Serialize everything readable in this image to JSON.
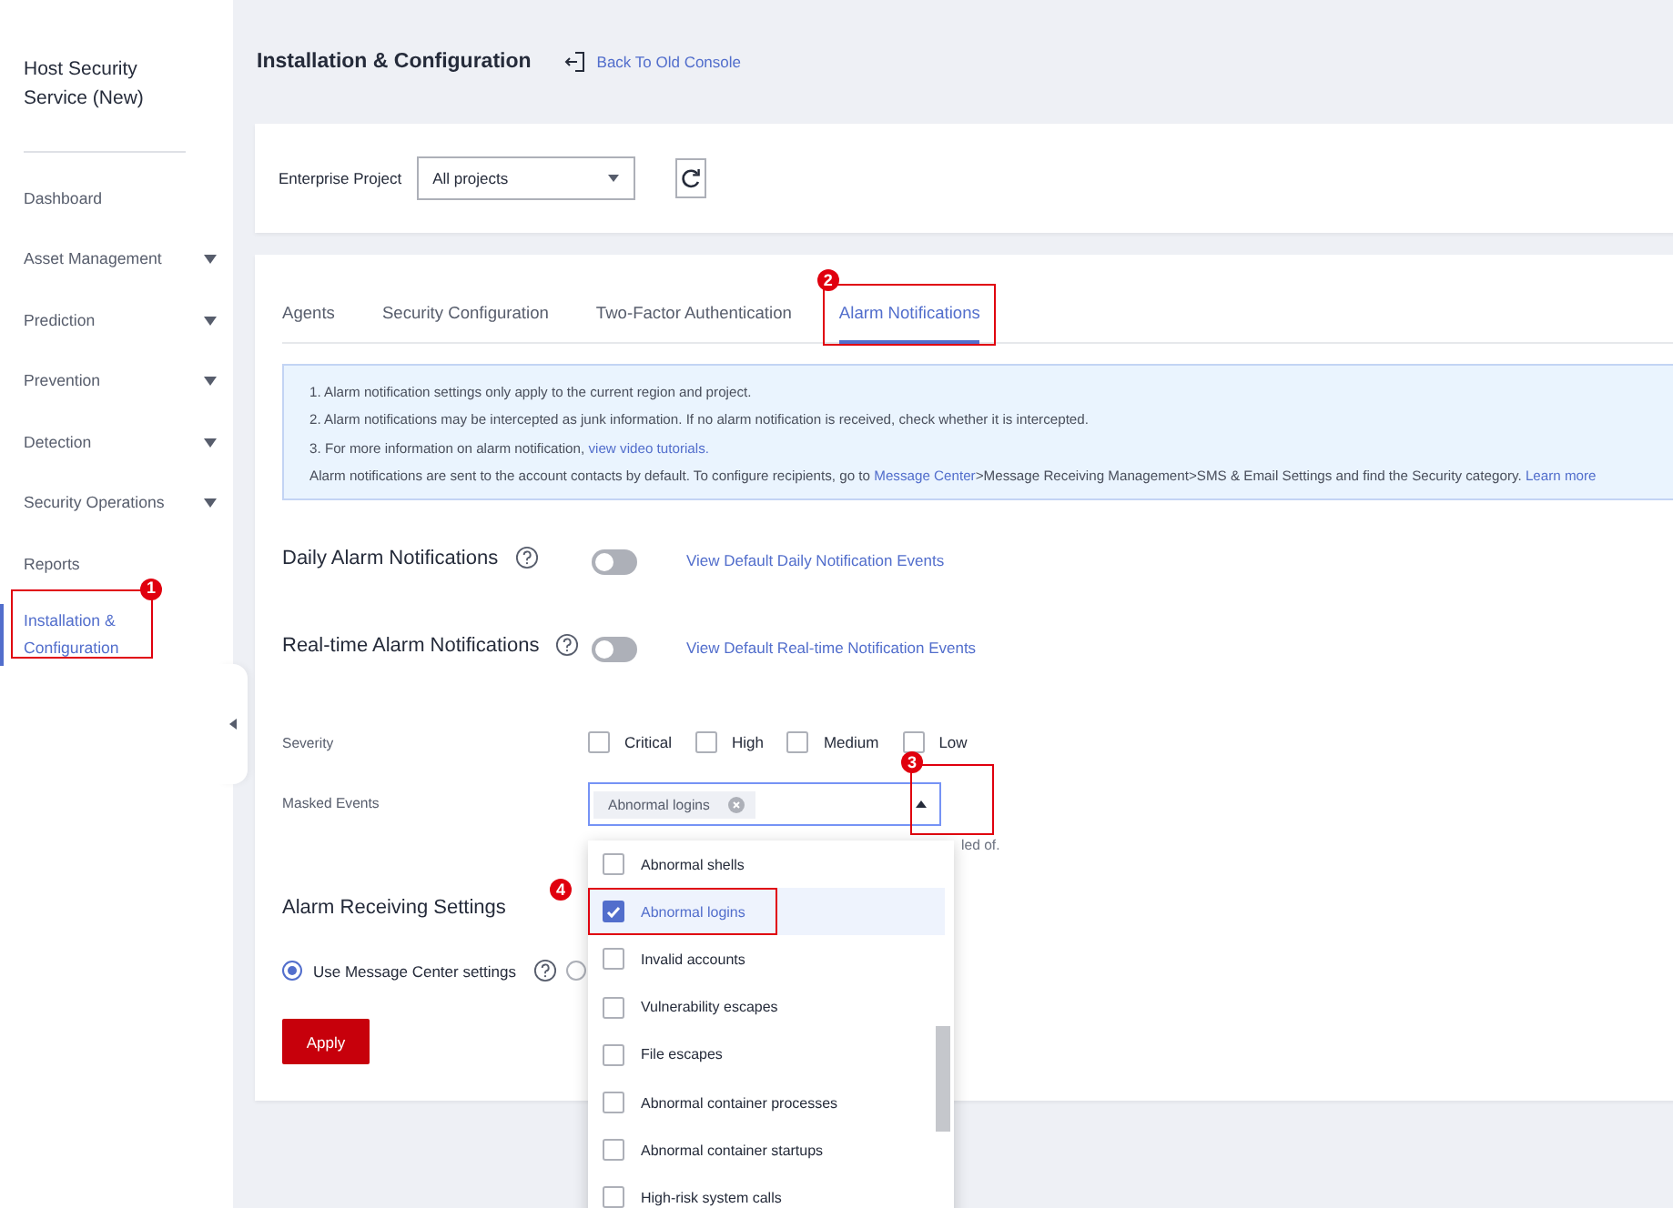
{
  "sidebar": {
    "title": "Host Security Service (New)",
    "items": [
      {
        "label": "Dashboard",
        "expandable": false,
        "selected": false
      },
      {
        "label": "Asset Management",
        "expandable": true,
        "selected": false
      },
      {
        "label": "Prediction",
        "expandable": true,
        "selected": false
      },
      {
        "label": "Prevention",
        "expandable": true,
        "selected": false
      },
      {
        "label": "Detection",
        "expandable": true,
        "selected": false
      },
      {
        "label": "Security Operations",
        "expandable": true,
        "selected": false
      },
      {
        "label": "Reports",
        "expandable": false,
        "selected": false
      },
      {
        "label": "Installation & Configuration",
        "expandable": false,
        "selected": true,
        "callout": "1"
      }
    ]
  },
  "header": {
    "title": "Installation & Configuration",
    "back_link": "Back To Old Console"
  },
  "project_filter": {
    "label": "Enterprise Project",
    "value": "All projects"
  },
  "tabs": [
    {
      "label": "Agents",
      "selected": false
    },
    {
      "label": "Security Configuration",
      "selected": false
    },
    {
      "label": "Two-Factor Authentication",
      "selected": false
    },
    {
      "label": "Alarm Notifications",
      "selected": true,
      "callout": "2"
    }
  ],
  "notice": {
    "lines": [
      [
        {
          "text": "1. Alarm notification settings only apply to the current region and project.",
          "link": false
        }
      ],
      [
        {
          "text": "2. Alarm notifications may be intercepted as junk information. If no alarm notification is received, check whether it is intercepted.",
          "link": false
        }
      ],
      [
        {
          "text": "3. For more information on alarm notification, ",
          "link": false
        },
        {
          "text": "view video tutorials.",
          "link": true
        }
      ],
      [
        {
          "text": "Alarm notifications are sent to the account contacts by default. To configure recipients, go to ",
          "link": false
        },
        {
          "text": "Message Center",
          "link": true
        },
        {
          "text": ">Message Receiving Management>SMS & Email Settings and find the Security category.",
          "link": false
        },
        {
          "text": "Learn more",
          "link": true
        }
      ]
    ]
  },
  "notifications": [
    {
      "label": "Daily Alarm Notifications",
      "on": false,
      "link": "View Default Daily Notification Events"
    },
    {
      "label": "Real-time Alarm Notifications",
      "on": false,
      "link": "View Default Real-time Notification Events"
    }
  ],
  "severity": {
    "label": "Severity",
    "options": [
      {
        "label": "Critical",
        "checked": false
      },
      {
        "label": "High",
        "checked": false
      },
      {
        "label": "Medium",
        "checked": false
      },
      {
        "label": "Low",
        "checked": false
      }
    ]
  },
  "masked_events": {
    "label": "Masked Events",
    "tags": [
      "Abnormal logins"
    ],
    "expanded": true,
    "callout": "3",
    "hint": "led of.",
    "options": [
      {
        "label": "Abnormal shells",
        "checked": false
      },
      {
        "label": "Abnormal logins",
        "checked": true,
        "callout": "4"
      },
      {
        "label": "Invalid accounts",
        "checked": false
      },
      {
        "label": "Vulnerability escapes",
        "checked": false
      },
      {
        "label": "File escapes",
        "checked": false
      },
      {
        "label": "Abnormal container processes",
        "checked": false
      },
      {
        "label": "Abnormal container startups",
        "checked": false
      },
      {
        "label": "High-risk system calls",
        "checked": false
      }
    ]
  },
  "receiving": {
    "title": "Alarm Receiving Settings",
    "options": [
      {
        "label": "Use Message Center settings",
        "selected": true,
        "help": true
      },
      {
        "selected": false
      }
    ]
  },
  "apply_button": "Apply"
}
